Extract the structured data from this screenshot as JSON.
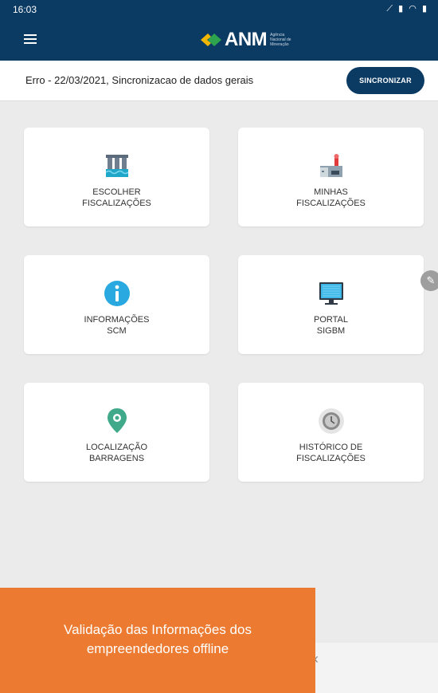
{
  "status_bar": {
    "time": "16:03",
    "icons": [
      "image-icon",
      "mail-icon",
      "cast-icon",
      "dot-icon",
      "signal-icon",
      "wifi-icon",
      "battery-icon"
    ]
  },
  "app_bar": {
    "logo_text": "ANM",
    "logo_subtitle": "Agência Nacional de Mineração",
    "color": "#0b3a63"
  },
  "sync": {
    "message": "Erro - 22/03/2021, Sincronizacao de dados gerais",
    "button_label": "SINCRONIZAR"
  },
  "cards": [
    {
      "line1": "ESCOLHER",
      "line2": "FISCALIZAÇÕES",
      "icon": "dam-icon"
    },
    {
      "line1": "MINHAS",
      "line2": "FISCALIZAÇÕES",
      "icon": "factory-icon"
    },
    {
      "line1": "INFORMAÇÕES",
      "line2": "SCM",
      "icon": "info-icon"
    },
    {
      "line1": "PORTAL",
      "line2": "SIGBM",
      "icon": "monitor-icon"
    },
    {
      "line1": "LOCALIZAÇÃO",
      "line2": "BARRAGENS",
      "icon": "location-pin-icon"
    },
    {
      "line1": "HISTÓRICO DE",
      "line2": "FISCALIZAÇÕES",
      "icon": "history-icon"
    }
  ],
  "banner": {
    "line1": "Validação das Informações dos",
    "line2": "empreendedores offline",
    "color": "#ec7a30"
  }
}
